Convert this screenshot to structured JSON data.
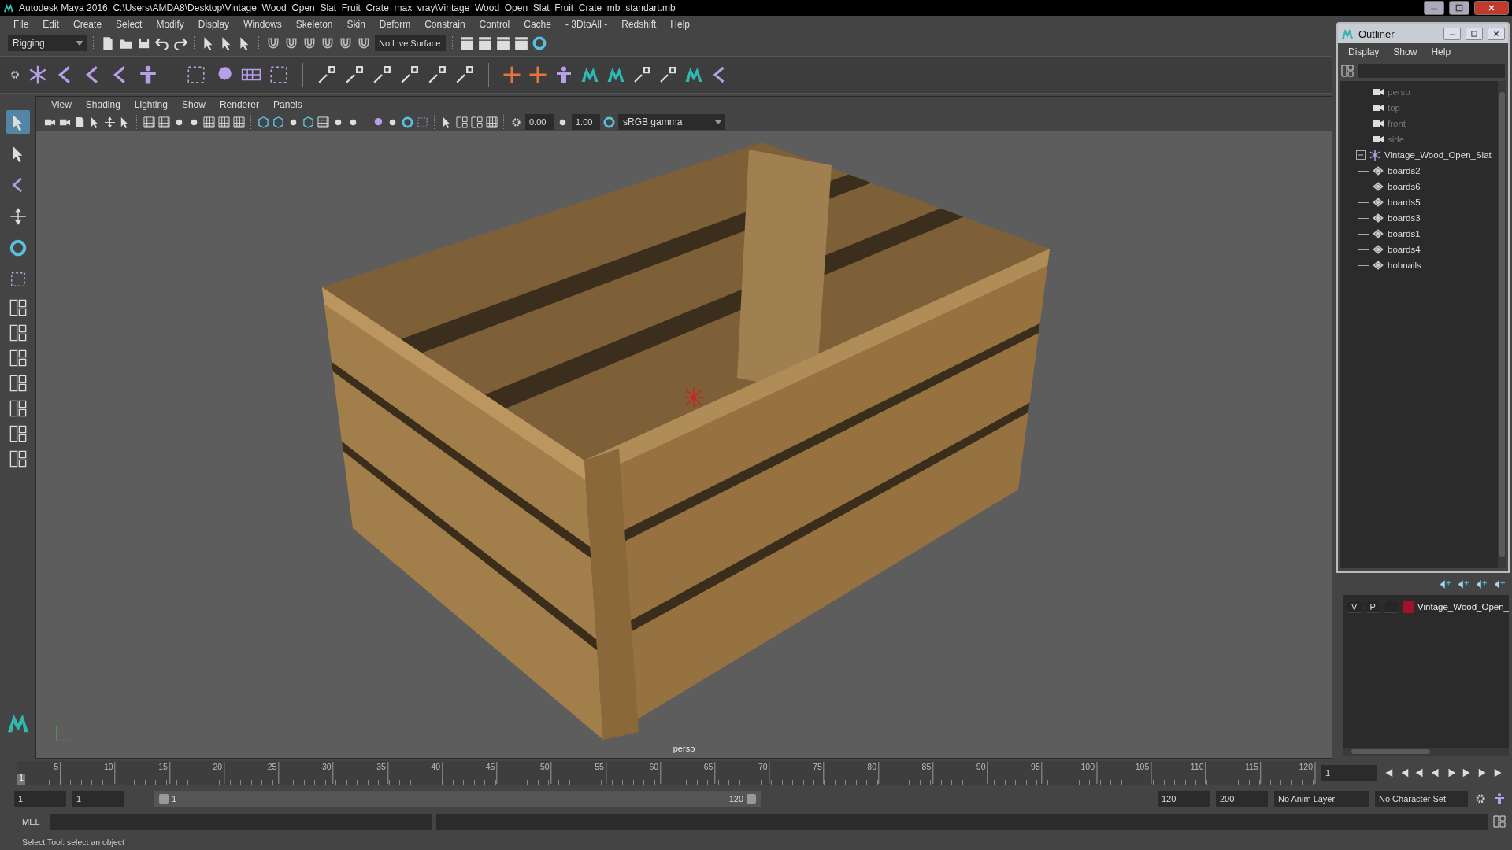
{
  "window": {
    "title": "Autodesk Maya 2016: C:\\Users\\AMDA8\\Desktop\\Vintage_Wood_Open_Slat_Fruit_Crate_max_vray\\Vintage_Wood_Open_Slat_Fruit_Crate_mb_standart.mb"
  },
  "menus": [
    "File",
    "Edit",
    "Create",
    "Select",
    "Modify",
    "Display",
    "Windows",
    "Skeleton",
    "Skin",
    "Deform",
    "Constrain",
    "Control",
    "Cache",
    "- 3DtoAll -",
    "Redshift",
    "Help"
  ],
  "status_line": {
    "menu_set": "Rigging",
    "live_surface": "No Live Surface"
  },
  "viewport": {
    "menus": [
      "View",
      "Shading",
      "Lighting",
      "Show",
      "Renderer",
      "Panels"
    ],
    "exposure": "0.00",
    "gamma": "1.00",
    "color_space": "sRGB gamma",
    "camera_label": "persp"
  },
  "outliner": {
    "title": "Outliner",
    "menus": [
      "Display",
      "Show",
      "Help"
    ],
    "items": [
      {
        "name": "persp",
        "kind": "camera",
        "dimmed": true
      },
      {
        "name": "top",
        "kind": "camera",
        "dimmed": true
      },
      {
        "name": "front",
        "kind": "camera",
        "dimmed": true
      },
      {
        "name": "side",
        "kind": "camera",
        "dimmed": true
      },
      {
        "name": "Vintage_Wood_Open_Slat",
        "kind": "group",
        "dimmed": false,
        "expanded": true,
        "children": [
          {
            "name": "boards2",
            "kind": "mesh",
            "dimmed": false
          },
          {
            "name": "boards6",
            "kind": "mesh",
            "dimmed": false
          },
          {
            "name": "boards5",
            "kind": "mesh",
            "dimmed": false
          },
          {
            "name": "boards3",
            "kind": "mesh",
            "dimmed": false
          },
          {
            "name": "boards1",
            "kind": "mesh",
            "dimmed": false
          },
          {
            "name": "boards4",
            "kind": "mesh",
            "dimmed": false
          },
          {
            "name": "hobnails",
            "kind": "mesh",
            "dimmed": false
          }
        ]
      }
    ]
  },
  "layers": [
    {
      "visible": "V",
      "playback": "P",
      "name": "Vintage_Wood_Open_",
      "color": "#a3102c"
    }
  ],
  "timeline": {
    "ticks": [
      "5",
      "10",
      "15",
      "20",
      "25",
      "30",
      "35",
      "40",
      "45",
      "50",
      "55",
      "60",
      "65",
      "70",
      "75",
      "80",
      "85",
      "90",
      "95",
      "100",
      "105",
      "110",
      "115",
      "120"
    ],
    "current_frame": "1",
    "frame_field": "1"
  },
  "range": {
    "level": 1,
    "start": "1",
    "playback_start": "1",
    "slider_start": "1",
    "slider_end": "120",
    "playback_end": "120",
    "end": "200",
    "anim_layer": "No Anim Layer",
    "character_set": "No Character Set"
  },
  "command_line": {
    "language": "MEL"
  },
  "help_line": "Select Tool: select an object"
}
